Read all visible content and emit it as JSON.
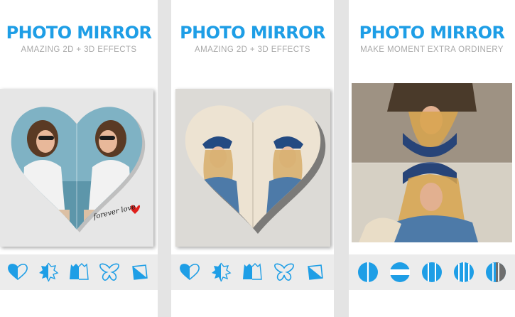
{
  "panels": [
    {
      "title": "PHOTO MIRROR",
      "subtitle": "AMAZING 2D + 3D EFFECTS",
      "caption": "forever love",
      "tools": [
        "heart-shape-icon",
        "leaf-shape-icon",
        "cat-shape-icon",
        "butterfly-shape-icon",
        "square-shape-icon"
      ]
    },
    {
      "title": "PHOTO MIRROR",
      "subtitle": "AMAZING 2D + 3D EFFECTS",
      "tools": [
        "heart-shape-icon",
        "leaf-shape-icon",
        "cat-shape-icon",
        "butterfly-shape-icon",
        "square-shape-icon"
      ]
    },
    {
      "title": "PHOTO MIRROR",
      "subtitle": "MAKE MOMENT EXTRA ORDINERY",
      "tools": [
        "mirror-vertical-split-icon",
        "mirror-horizontal-split-icon",
        "mirror-triple-vertical-icon",
        "mirror-quad-vertical-icon",
        "mirror-half-dark-icon"
      ]
    }
  ],
  "colors": {
    "accent": "#1e9ee6",
    "subtitle": "#a9a9a9",
    "toolbar_bg": "#ececec",
    "background": "#e4e4e4",
    "heart_accent": "#e0201c"
  }
}
